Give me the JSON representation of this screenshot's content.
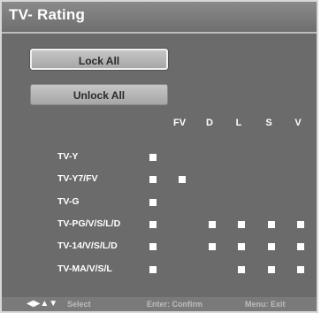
{
  "title": "TV- Rating",
  "buttons": {
    "lock_all": "Lock All",
    "unlock_all": "Unlock All"
  },
  "columns": [
    "FV",
    "D",
    "L",
    "S",
    "V"
  ],
  "rows": [
    {
      "label": "TV-Y",
      "all": true,
      "FV": false,
      "D": false,
      "L": false,
      "S": false,
      "V": false
    },
    {
      "label": "TV-Y7/FV",
      "all": true,
      "FV": true,
      "D": false,
      "L": false,
      "S": false,
      "V": false
    },
    {
      "label": "TV-G",
      "all": true,
      "FV": false,
      "D": false,
      "L": false,
      "S": false,
      "V": false
    },
    {
      "label": "TV-PG/V/S/L/D",
      "all": true,
      "FV": false,
      "D": true,
      "L": true,
      "S": true,
      "V": true
    },
    {
      "label": "TV-14/V/S/L/D",
      "all": true,
      "FV": false,
      "D": true,
      "L": true,
      "S": true,
      "V": true
    },
    {
      "label": "TV-MA/V/S/L",
      "all": true,
      "FV": false,
      "D": false,
      "L": true,
      "S": true,
      "V": true
    }
  ],
  "footer": {
    "nav_icons": "◀▶▲▼",
    "nav_label": "Select",
    "confirm": "Enter: Confirm",
    "exit": "Menu: Exit"
  }
}
